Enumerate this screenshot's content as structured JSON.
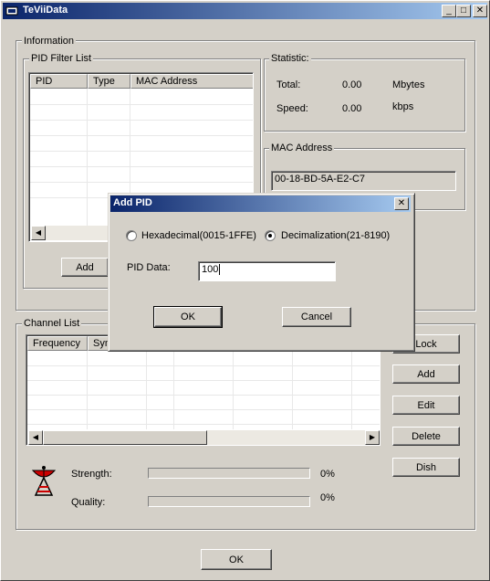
{
  "window": {
    "title": "TeViiData",
    "minimize": "_",
    "maximize": "□",
    "close": "✕"
  },
  "information": {
    "label": "Information",
    "pid_filter": {
      "label": "PID Filter List",
      "columns": [
        "PID",
        "Type",
        "MAC Address"
      ],
      "add_label": "Add"
    },
    "statistic": {
      "label": "Statistic:",
      "total_label": "Total:",
      "total_value": "0.00",
      "total_unit": "Mbytes",
      "speed_label": "Speed:",
      "speed_value": "0.00",
      "speed_unit": "kbps"
    },
    "mac": {
      "label": "MAC Address",
      "value": "00-18-BD-5A-E2-C7"
    }
  },
  "channel_list": {
    "label": "Channel List",
    "columns": [
      "Frequency",
      "Sym"
    ],
    "buttons": {
      "lock": "Lock",
      "add": "Add",
      "edit": "Edit",
      "delete": "Delete",
      "dish": "Dish"
    },
    "strength_label": "Strength:",
    "strength_value": "0%",
    "strength_level": 0,
    "quality_label": "Quality:",
    "quality_value": "0%",
    "quality_level": 0
  },
  "ok_label": "OK",
  "dialog": {
    "title": "Add PID",
    "close": "✕",
    "radio_hex": "Hexadecimal(0015-1FFE)",
    "radio_dec": "Decimalization(21-8190)",
    "selected": "decimal",
    "pid_label": "PID Data:",
    "pid_value": "100",
    "ok_label": "OK",
    "cancel_label": "Cancel"
  },
  "colors": {
    "title_start": "#0a246a",
    "title_end": "#a6caf0",
    "face": "#d4d0c8",
    "dish_icon": "#cc0000"
  }
}
